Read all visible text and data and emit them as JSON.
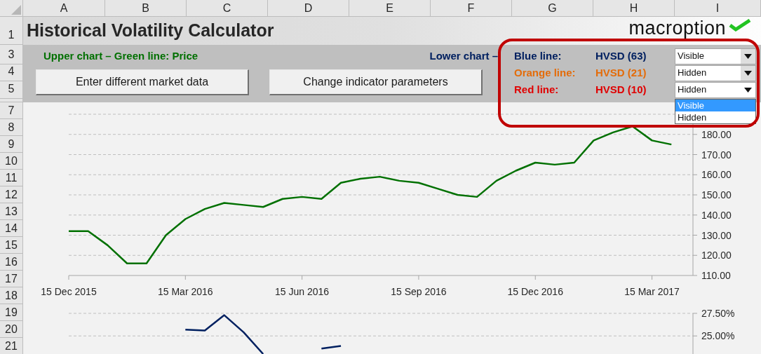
{
  "sheet": {
    "columns": [
      "A",
      "B",
      "C",
      "D",
      "E",
      "F",
      "G",
      "H",
      "I"
    ],
    "top_rows": [
      "1",
      "3",
      "4",
      "5"
    ],
    "chart_rows": [
      "7",
      "8",
      "9",
      "10",
      "11",
      "12",
      "13",
      "14",
      "15",
      "16",
      "17",
      "18",
      "19",
      "20",
      "21"
    ]
  },
  "title": "Historical Volatility Calculator",
  "logo": "macroption",
  "upper_label": "Upper chart – Green line: Price",
  "lower_label": "Lower chart –",
  "buttons": [
    "Enter different market data",
    "Change indicator parameters"
  ],
  "lines": [
    {
      "label": "Blue line:",
      "indicator": "HVSD (63)",
      "color": "#002060",
      "dropdown": {
        "value": "Visible",
        "open": false
      }
    },
    {
      "label": "Orange line:",
      "indicator": "HVSD (21)",
      "color": "#e46c0a",
      "dropdown": {
        "value": "Hidden",
        "open": false
      }
    },
    {
      "label": "Red line:",
      "indicator": "HVSD (10)",
      "color": "#e00000",
      "dropdown": {
        "value": "Hidden",
        "open": true,
        "options": [
          {
            "label": "Visible",
            "highlighted": true
          },
          {
            "label": "Hidden",
            "highlighted": false
          }
        ]
      }
    }
  ],
  "upper_chart": {
    "chart_data": {
      "type": "line",
      "categories": [
        "15 Dec 2015",
        null,
        null,
        null,
        null,
        null,
        "15 Mar 2016",
        null,
        null,
        null,
        null,
        null,
        "15 Jun 2016",
        null,
        null,
        null,
        null,
        null,
        "15 Sep 2016",
        null,
        null,
        null,
        null,
        null,
        "15 Dec 2016",
        null,
        null,
        null,
        null,
        null,
        "15 Mar 2017",
        null
      ],
      "series": [
        {
          "color": "#007000",
          "values": [
            132,
            132,
            125,
            116,
            116,
            130,
            138,
            143,
            146,
            145,
            144,
            148,
            149,
            148,
            156,
            158,
            159,
            157,
            156,
            153,
            150,
            149,
            157,
            162,
            166,
            165,
            166,
            177,
            181,
            184,
            177,
            175
          ]
        }
      ],
      "ylim": [
        110,
        190
      ],
      "grid": true,
      "yticks": [
        {
          "value": 110,
          "label": "110.00"
        },
        {
          "value": 120,
          "label": "120.00"
        },
        {
          "value": 130,
          "label": "130.00"
        },
        {
          "value": 140,
          "label": "140.00"
        },
        {
          "value": 150,
          "label": "150.00"
        },
        {
          "value": 160,
          "label": "160.00"
        },
        {
          "value": 170,
          "label": "170.00"
        },
        {
          "value": 180,
          "label": "180.00"
        }
      ]
    }
  },
  "lower_chart": {
    "chart_data": {
      "type": "line",
      "categories": [
        null,
        null,
        null,
        null,
        null,
        null,
        null,
        null,
        null,
        null,
        null,
        null,
        null,
        null,
        null,
        null,
        null,
        null,
        null,
        null,
        null,
        null,
        null,
        null,
        null,
        null,
        null,
        null,
        null,
        null,
        null,
        null
      ],
      "series": [
        {
          "color": "#002060",
          "values": [
            null,
            null,
            null,
            null,
            null,
            null,
            25.7,
            25.6,
            27.3,
            25.4,
            23.0,
            null,
            null,
            23.6,
            23.9,
            null,
            null,
            null,
            null,
            null,
            null,
            null,
            null,
            null,
            null,
            null,
            null,
            null,
            null,
            null,
            null,
            null
          ]
        }
      ],
      "ylim": [
        23,
        27.5
      ],
      "grid": true,
      "yticks": [
        {
          "value": 27.5,
          "label": "27.50%"
        },
        {
          "value": 25,
          "label": "25.00%"
        }
      ]
    }
  }
}
